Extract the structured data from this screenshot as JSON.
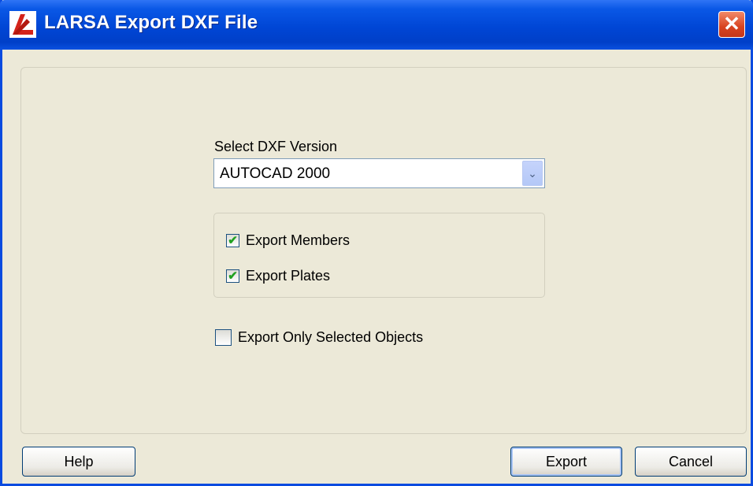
{
  "window": {
    "title": "LARSA Export DXF File",
    "close_glyph": "✕"
  },
  "icons": {
    "app": "larsa-logo-icon",
    "close": "close-icon",
    "dropdown": "chevron-down-icon",
    "check": "checkmark-icon"
  },
  "dxf_version": {
    "label": "Select DXF Version",
    "selected": "AUTOCAD 2000",
    "arrow": "⌄"
  },
  "options": {
    "export_members": {
      "label": "Export Members",
      "checked": true,
      "mark": "✔"
    },
    "export_plates": {
      "label": "Export Plates",
      "checked": true,
      "mark": "✔"
    },
    "export_only_selected": {
      "label": "Export Only Selected Objects",
      "checked": false,
      "mark": ""
    }
  },
  "buttons": {
    "help": "Help",
    "export": "Export",
    "cancel": "Cancel"
  },
  "colors": {
    "title_bar": "#0046d5",
    "dialog_bg": "#ece9d8",
    "close_red": "#d8431f",
    "check_green": "#21a121"
  }
}
